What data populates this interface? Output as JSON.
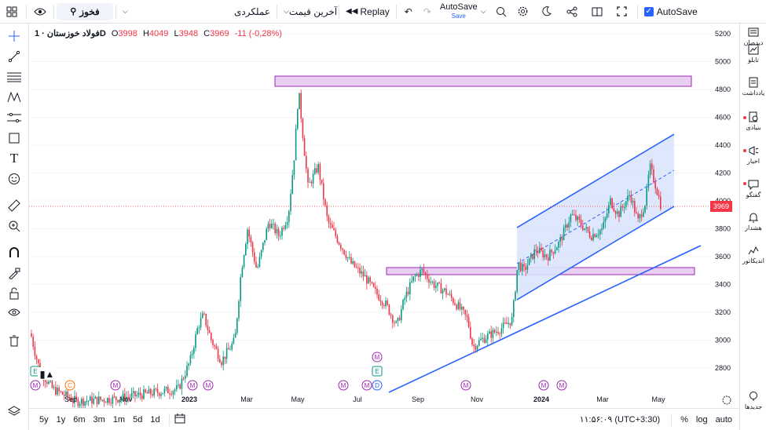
{
  "toolbar": {
    "symbol": "فخوز",
    "layout_select": "عملکردی",
    "price_type": "آخرین قیمت",
    "replay": "Replay",
    "autosave_title": "AutoSave",
    "autosave_sub": "Save",
    "autosave_toggle": "AutoSave"
  },
  "legend": {
    "title": "فولاد خوزستان · 1D",
    "o_label": "O",
    "o": "3998",
    "h_label": "H",
    "h": "4049",
    "l_label": "L",
    "l": "3948",
    "c_label": "C",
    "c": "3969",
    "change": "-11 (-0,28%)"
  },
  "right_sidebar": [
    {
      "label": "دیده‌بان",
      "icon": "watchlist-icon"
    },
    {
      "label": "تابلو",
      "icon": "board-icon"
    },
    {
      "label": "یادداشت",
      "icon": "notes-icon"
    },
    {
      "label": "بنیادی",
      "icon": "fundamentals-icon"
    },
    {
      "label": "اخبار",
      "icon": "news-icon"
    },
    {
      "label": "گفتگو",
      "icon": "chat-icon"
    },
    {
      "label": "هشدار",
      "icon": "alert-icon"
    },
    {
      "label": "اندیکاتور",
      "icon": "indicator-icon"
    },
    {
      "label": "جدیدها",
      "icon": "new-icon"
    }
  ],
  "price_axis": [
    "5200",
    "5000",
    "4800",
    "4600",
    "4400",
    "4200",
    "4000",
    "3800",
    "3600",
    "3400",
    "3200",
    "3000",
    "2800"
  ],
  "current_price_tag": "3969",
  "time_axis": [
    {
      "label": "Sep",
      "bold": false
    },
    {
      "label": "Nov",
      "bold": false
    },
    {
      "label": "2023",
      "bold": true
    },
    {
      "label": "Mar",
      "bold": false
    },
    {
      "label": "May",
      "bold": false
    },
    {
      "label": "Jul",
      "bold": false
    },
    {
      "label": "Sep",
      "bold": false
    },
    {
      "label": "Nov",
      "bold": false
    },
    {
      "label": "2024",
      "bold": true
    },
    {
      "label": "Mar",
      "bold": false
    },
    {
      "label": "May",
      "bold": false
    }
  ],
  "event_markers": [
    "E",
    "C",
    "M",
    "M",
    "M",
    "M",
    "M",
    "M",
    "D",
    "M",
    "E",
    "M",
    "M",
    "M",
    "M"
  ],
  "ranges": [
    "5y",
    "1y",
    "6m",
    "3m",
    "1m",
    "5d",
    "1d"
  ],
  "bottom_right": {
    "clock": "۱۱:۵۶:۰۹ (UTC+3:30)",
    "percent": "%",
    "log": "log",
    "auto": "auto"
  },
  "colors": {
    "up": "#089981",
    "down": "#f23645",
    "zone_fill": "#e6c8f0",
    "zone_stroke": "#9c27b0",
    "channel": "#2962ff",
    "channel_fill": "#c7d6fb"
  }
}
